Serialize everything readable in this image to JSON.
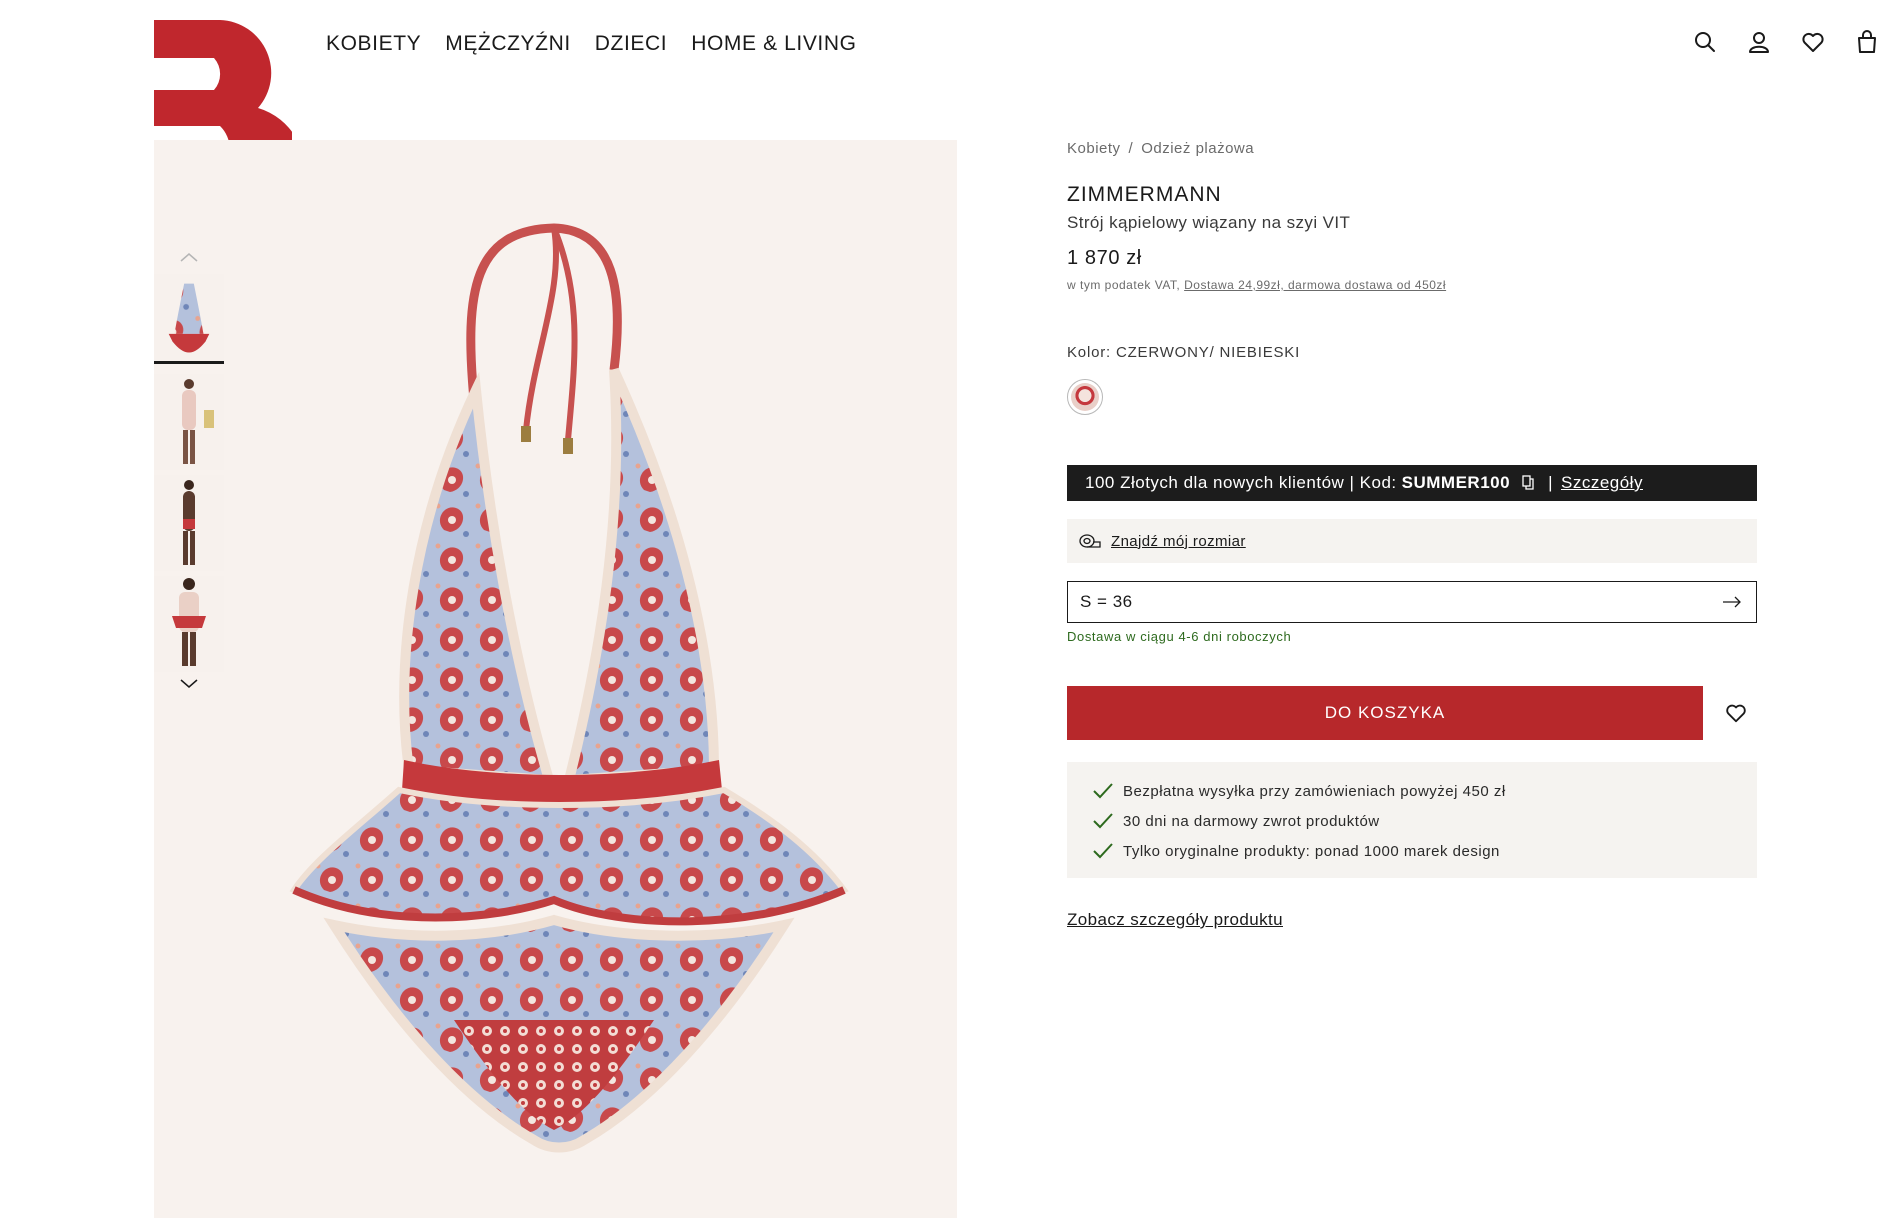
{
  "nav": {
    "items": [
      "KOBIETY",
      "MĘŻCZYŹNI",
      "DZIECI",
      "HOME & LIVING"
    ]
  },
  "header_icons": [
    "search-icon",
    "account-icon",
    "wishlist-icon",
    "bag-icon"
  ],
  "product": {
    "breadcrumb": [
      "Kobiety",
      "Odzież plażowa"
    ],
    "breadcrumb_separator": "/",
    "brand": "ZIMMERMANN",
    "name": "Strój kąpielowy wiązany na szyi VIT",
    "price": "1 870 zł",
    "vat_text": "w tym podatek VAT,",
    "shipping_link": "Dostawa 24,99zł, darmowa dostawa od 450zł",
    "color_label": "Kolor: CZERWONY/ NIEBIESKI",
    "promo_text": "100 Złotych dla nowych klientów | Kod:",
    "promo_code": "SUMMER100",
    "promo_separator": "|",
    "promo_details": "Szczegóły",
    "size_finder": "Znajdź mój rozmiar",
    "size_selected": "S = 36",
    "delivery_time": "Dostawa w ciągu 4-6 dni roboczych",
    "add_to_cart": "DO KOSZYKA",
    "benefits": [
      "Bezpłatna wysyłka przy zamówieniach powyżej 450 zł",
      "30 dni na darmowy zwrot produktów",
      "Tylko oryginalne produkty: ponad 1000 marek design"
    ],
    "see_details": "Zobacz szczegóły produktu"
  },
  "colors": {
    "brand_red": "#b7282b",
    "promo_bg": "#1c1c1c",
    "delivery_green": "#2d6a1e",
    "image_bg": "#f8f2ee"
  }
}
